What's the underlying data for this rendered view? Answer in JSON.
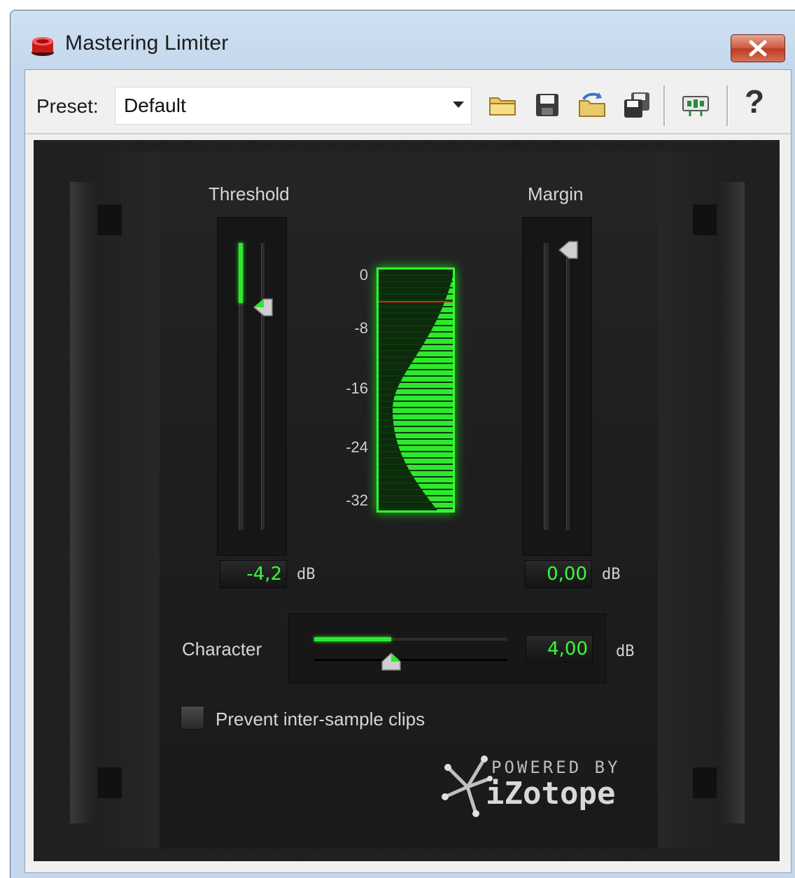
{
  "window": {
    "title": "Mastering Limiter"
  },
  "toolbar": {
    "preset_label": "Preset:",
    "preset_value": "Default",
    "help_label": "?"
  },
  "plugin": {
    "threshold": {
      "label": "Threshold",
      "value": "-4,2",
      "unit": "dB",
      "level": 0.21
    },
    "margin": {
      "label": "Margin",
      "value": "0,00",
      "unit": "dB",
      "level": 1.0
    },
    "meter": {
      "ticks": [
        "0",
        "-8",
        "-16",
        "-24",
        "-32"
      ]
    },
    "character": {
      "label": "Character",
      "value": "4,00",
      "unit": "dB",
      "level": 0.4
    },
    "prevent_clips": {
      "label": "Prevent inter-sample clips",
      "checked": false
    },
    "brand": {
      "line1": "POWERED BY",
      "line2": "iZotope"
    }
  },
  "colors": {
    "accent_green": "#2ee82e",
    "readout_green": "#35ff35",
    "meter_red_line": "#e02020"
  },
  "icons": [
    "app-icon",
    "close-icon",
    "chevron-down-icon",
    "open-folder-icon",
    "save-icon",
    "load-preset-icon",
    "copy-icon",
    "routing-icon",
    "help-icon"
  ]
}
